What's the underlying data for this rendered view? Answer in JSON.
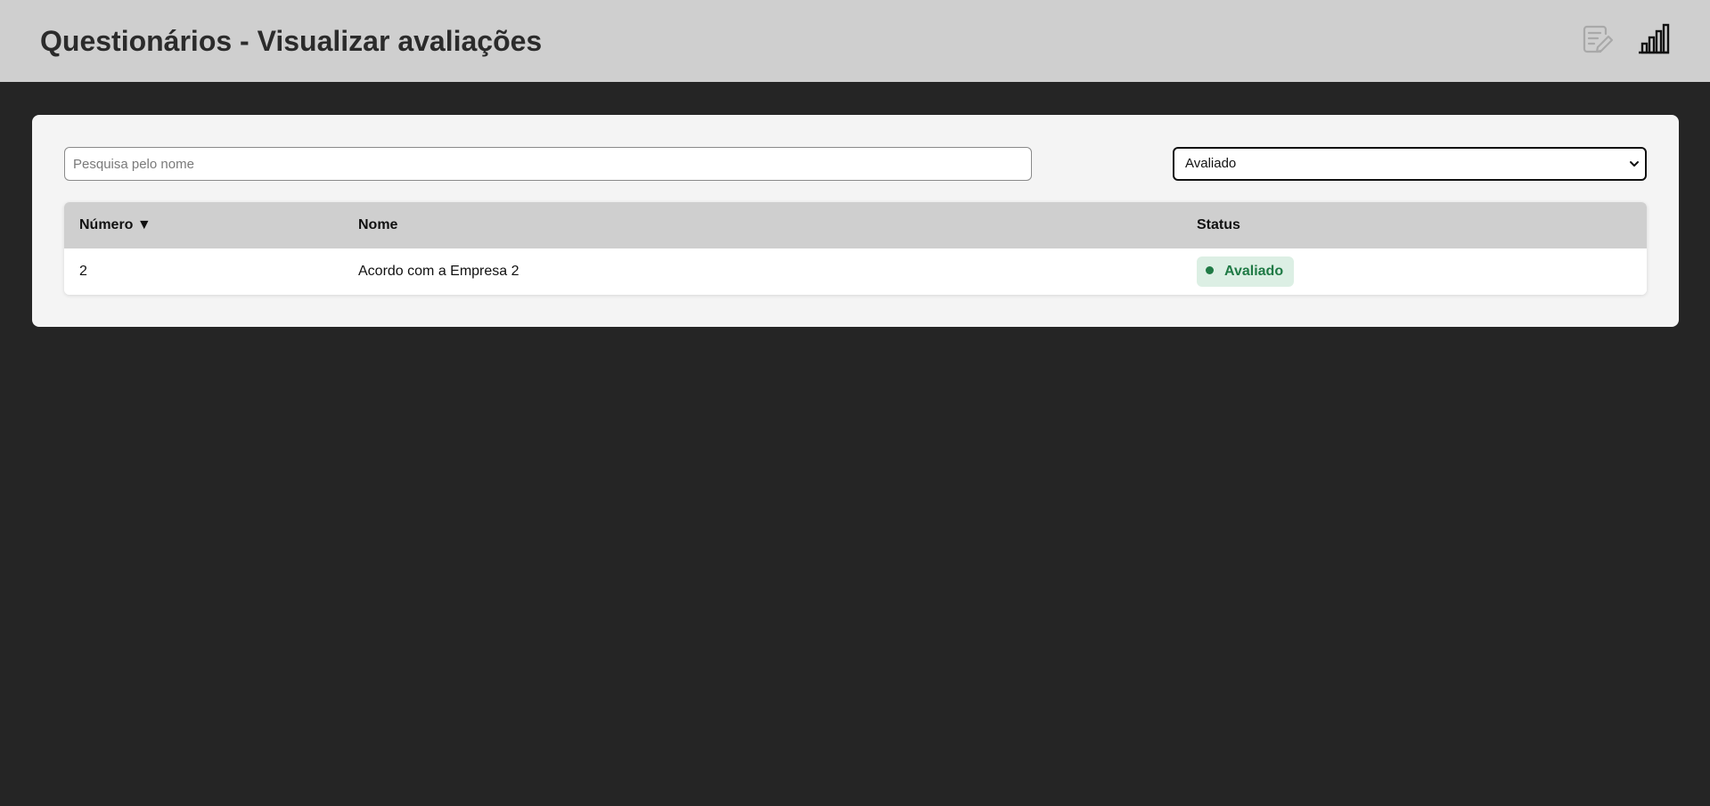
{
  "header": {
    "title": "Questionários - Visualizar avaliações",
    "icons": [
      "edit-document-icon",
      "bar-chart-icon"
    ]
  },
  "filters": {
    "search_placeholder": "Pesquisa pelo nome",
    "search_value": "",
    "status_selected": "Avaliado"
  },
  "table": {
    "columns": [
      "Número ▼",
      "Nome",
      "Status"
    ],
    "rows": [
      {
        "numero": "2",
        "nome": "Acordo com a Empresa 2",
        "status": "Avaliado"
      }
    ]
  },
  "colors": {
    "header_bg": "#cfcfcf",
    "page_bg": "#252525",
    "card_bg": "#f4f4f4",
    "status_badge_bg": "#dcefe4",
    "status_badge_text": "#1f7a45"
  }
}
